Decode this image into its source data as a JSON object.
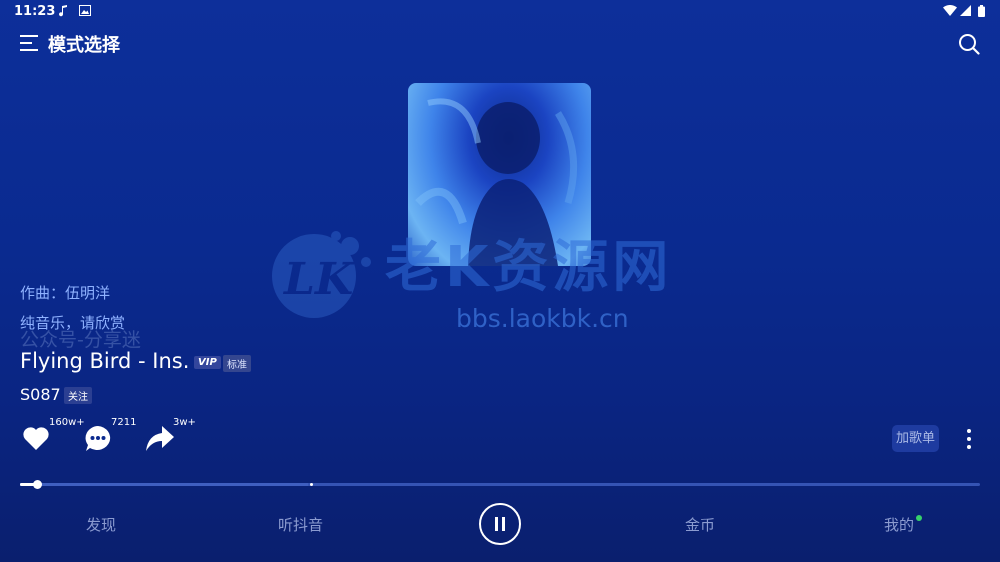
{
  "status_bar": {
    "time": "11:23"
  },
  "header": {
    "title": "模式选择"
  },
  "song": {
    "composer": "作曲：伍明洋",
    "description": "纯音乐，请欣赏",
    "title": "Flying Bird - Ins.",
    "vip_badge": "VIP",
    "quality_badge": "标准",
    "artist": "S087",
    "follow_label": "关注"
  },
  "actions": {
    "like_count": "160w+",
    "comment_count": "7211",
    "share_count": "3w+",
    "add_playlist_label": "加歌单"
  },
  "playback": {
    "progress": 0.018,
    "buffered": 0.3
  },
  "watermark": {
    "logo_text": "LK",
    "text": "老K资源网",
    "url": "bbs.laokbk.cn",
    "public_account": "公众号-分享迷"
  },
  "bottom_nav": {
    "discover": "发现",
    "listen": "听抖音",
    "coins": "金币",
    "mine": "我的"
  },
  "colors": {
    "background": "#0b2a8f",
    "accent_text": "#8fb2ff",
    "nav_text": "#8b9bd0",
    "notification_dot": "#36d16a"
  },
  "icons": {
    "menu": "menu-icon",
    "search": "search-icon",
    "like": "heart-icon",
    "comment": "comment-icon",
    "share": "share-icon",
    "more": "more-vertical-icon",
    "pause": "pause-icon"
  }
}
